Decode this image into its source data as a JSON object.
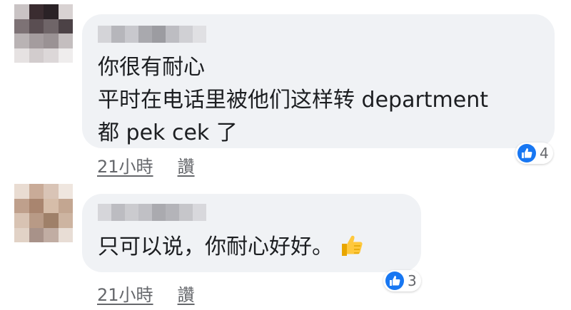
{
  "comments": [
    {
      "text": "你很有耐心\n平时在电话里被他们这样转 department\n都 pek cek 了",
      "reaction_count": "4",
      "time": "21小時",
      "like_label": "讚"
    },
    {
      "text": "只可以说，你耐心好好。",
      "emoji": "thumbs-up-emoji",
      "reaction_count": "3",
      "time": "21小時",
      "like_label": "讚"
    }
  ],
  "colors": {
    "bubble": "#f0f2f5",
    "like_blue": "#1877f2",
    "meta_gray": "#65676b"
  }
}
